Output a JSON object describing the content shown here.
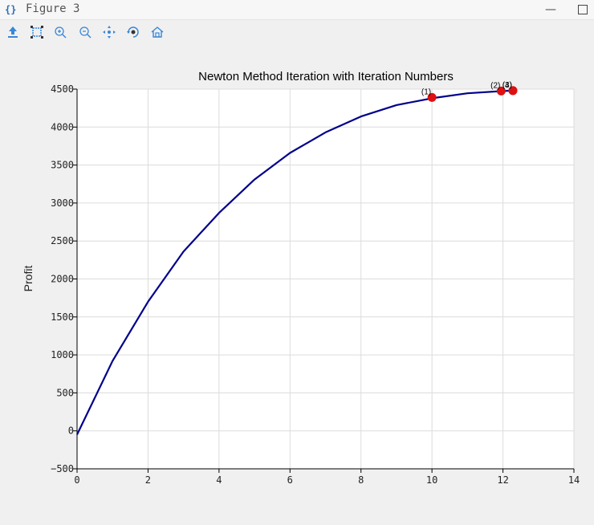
{
  "window": {
    "title": "Figure 3"
  },
  "toolbar": {
    "tools": [
      "save-icon",
      "subplots-icon",
      "zoom-in-icon",
      "zoom-out-icon",
      "pan-icon",
      "rotate-icon",
      "home-icon"
    ]
  },
  "chart_data": {
    "type": "line",
    "title": "Newton Method Iteration with Iteration Numbers",
    "xlabel": "",
    "ylabel": "Profit",
    "xlim": [
      0,
      14
    ],
    "ylim": [
      -500,
      4500
    ],
    "xticks": [
      0,
      2,
      4,
      6,
      8,
      10,
      12,
      14
    ],
    "yticks": [
      -500,
      0,
      500,
      1000,
      1500,
      2000,
      2500,
      3000,
      3500,
      4000,
      4500
    ],
    "grid": true,
    "series": [
      {
        "color": "#00008b",
        "x": [
          0,
          1,
          2,
          3,
          4,
          5,
          6,
          7,
          8,
          9,
          10,
          11,
          12,
          12.3
        ],
        "y": [
          -50,
          920,
          1700,
          2360,
          2870,
          3310,
          3660,
          3930,
          4140,
          4290,
          4380,
          4445,
          4475,
          4480
        ]
      }
    ],
    "points": {
      "color": "#dd1111",
      "x": [
        10,
        11.95,
        12.28,
        12.28
      ],
      "y": [
        4390,
        4475,
        4480,
        4480
      ],
      "labels": [
        "(1)",
        "(2)",
        "(3)",
        "(4)"
      ]
    }
  }
}
